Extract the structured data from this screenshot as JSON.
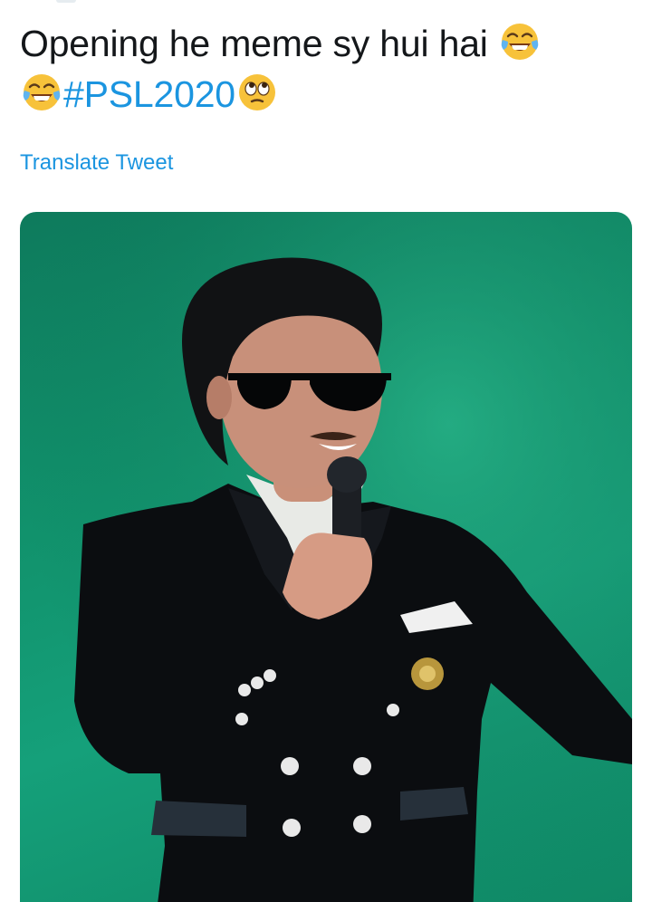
{
  "tweet": {
    "line1_text": "Opening he meme sy hui hai",
    "line1_emoji": "face-with-tears-of-joy",
    "line2_emoji_before": "face-with-tears-of-joy",
    "hashtag": "#PSL2020",
    "line2_emoji_after": "face-with-rolling-eyes"
  },
  "translate_link": "Translate Tweet",
  "media": {
    "description_icon": "photo",
    "background_color": "#13936d"
  },
  "colors": {
    "text": "#14171a",
    "link": "#1b95e0",
    "background": "#ffffff"
  }
}
